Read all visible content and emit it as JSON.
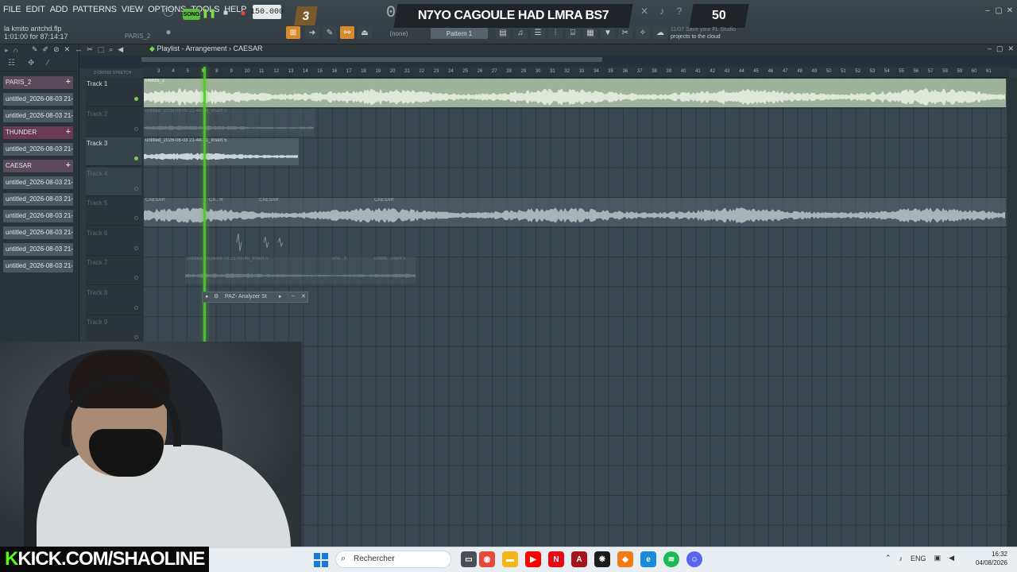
{
  "menu": [
    "FILE",
    "EDIT",
    "ADD",
    "PATTERNS",
    "VIEW",
    "OPTIONS",
    "TOOLS",
    "HELP"
  ],
  "project": {
    "name": "la kmito antchd.flp",
    "time": "1:01:00 for 87:14:17",
    "current_pattern": "PARIS_2"
  },
  "transport": {
    "song_label": "SONG",
    "tempo": "150.000",
    "step": "3",
    "time_display": "0:08"
  },
  "overlay": {
    "title": "N7YO CAGOULE HAD LMRA BS7",
    "count": "50"
  },
  "cloud_hint": {
    "line1": "11/07 Save your FL Studio",
    "line2": "projects to the cloud"
  },
  "pattern_selector": {
    "none": "(none)",
    "pattern": "Pattern 1"
  },
  "playlist": {
    "window_title": "Playlist - Arrangement",
    "breadcrumb": "CAESAR",
    "mode_labels": "2-CROSS STRETCH",
    "ruler": [
      "3",
      "4",
      "5",
      "7",
      "8",
      "9",
      "10",
      "11",
      "12",
      "13",
      "14",
      "15",
      "16",
      "17",
      "18",
      "19",
      "20",
      "21",
      "22",
      "23",
      "24",
      "25",
      "26",
      "27",
      "28",
      "29",
      "30",
      "31",
      "32",
      "33",
      "34",
      "35",
      "36",
      "37",
      "38",
      "39",
      "40",
      "41",
      "42",
      "43",
      "44",
      "45",
      "46",
      "47",
      "48",
      "49",
      "50",
      "51",
      "52",
      "53",
      "54",
      "55",
      "56",
      "57",
      "58",
      "59",
      "60",
      "61"
    ]
  },
  "browser": {
    "items": [
      {
        "label": "PARIS_2",
        "type": "pattern"
      },
      {
        "label": "untitled_2026-08-03 21-",
        "type": "audio"
      },
      {
        "label": "untitled_2026-08-03 21-",
        "type": "audio"
      },
      {
        "label": "THUNDER",
        "type": "pattern"
      },
      {
        "label": "untitled_2026-08-03 21-",
        "type": "audio"
      },
      {
        "label": "CAESAR",
        "type": "pattern"
      },
      {
        "label": "untitled_2026-08-03 21-",
        "type": "audio"
      },
      {
        "label": "untitled_2026-08-03 21-",
        "type": "audio"
      },
      {
        "label": "untitled_2026-08-03 21-",
        "type": "audio"
      },
      {
        "label": "untitled_2026-08-03 21-",
        "type": "audio"
      },
      {
        "label": "untitled_2026-08-03 21-",
        "type": "audio"
      },
      {
        "label": "untitled_2026-08-03 21-",
        "type": "audio"
      }
    ]
  },
  "tracks": [
    "Track 1",
    "Track 2",
    "Track 3",
    "Track 4",
    "Track 5",
    "Track 6",
    "Track 7",
    "Track 8",
    "Track 9"
  ],
  "clips": {
    "t1": "PARIS_2",
    "t2": "untitled_2026-08-03 21-44-08_Insert 5",
    "t3": "untitled_2026-08-03 21-44-31_Insert 5",
    "t5a": "CAESAR",
    "t5b": "CA...R",
    "t5c": "CAESAR",
    "t5d": "CAESAR",
    "t7a": "untitled_2026-08-03 21-50-40_Insert 5",
    "t7b": "unti...rt",
    "t7c": "untitle...nsert 5"
  },
  "plugin_window": {
    "title": "PAZ- Analyzer St"
  },
  "stream": {
    "kick": "KICK.COM/SHAOLINE"
  },
  "taskbar": {
    "search_placeholder": "Rechercher",
    "lang": "ENG",
    "time": "16:32",
    "date": "04/08/2026"
  },
  "colors": {
    "playhead": "#4ecb2a",
    "accent_orange": "#d88b2c",
    "kick_green": "#53fc18"
  }
}
